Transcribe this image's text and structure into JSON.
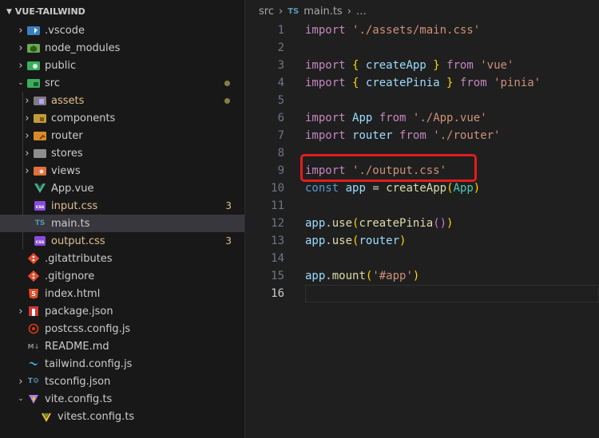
{
  "explorer": {
    "title": "VUE-TAILWIND",
    "items": [
      {
        "label": "vscode_dir",
        "text": ".vscode",
        "icon": "vscode-folder-icon"
      },
      {
        "label": "node_modules",
        "text": "node_modules",
        "icon": "node-folder-icon"
      },
      {
        "label": "public",
        "text": "public",
        "icon": "public-folder-icon"
      },
      {
        "label": "src",
        "text": "src",
        "icon": "src-folder-icon"
      },
      {
        "label": "assets",
        "text": "assets",
        "icon": "assets-folder-icon"
      },
      {
        "label": "components",
        "text": "components",
        "icon": "components-folder-icon"
      },
      {
        "label": "router",
        "text": "router",
        "icon": "router-folder-icon"
      },
      {
        "label": "stores",
        "text": "stores",
        "icon": "stores-folder-icon"
      },
      {
        "label": "views",
        "text": "views",
        "icon": "views-folder-icon"
      },
      {
        "label": "app_vue",
        "text": "App.vue",
        "icon": "vue-file-icon"
      },
      {
        "label": "input_css",
        "text": "input.css",
        "badge": "3",
        "icon": "css-file-icon"
      },
      {
        "label": "main_ts",
        "text": "main.ts",
        "icon": "ts-file-icon"
      },
      {
        "label": "output_css",
        "text": "output.css",
        "badge": "3",
        "icon": "css-file-icon"
      },
      {
        "label": "gitattributes",
        "text": ".gitattributes",
        "icon": "git-file-icon"
      },
      {
        "label": "gitignore",
        "text": ".gitignore",
        "icon": "git-file-icon"
      },
      {
        "label": "index_html",
        "text": "index.html",
        "icon": "html-file-icon"
      },
      {
        "label": "package_json",
        "text": "package.json",
        "icon": "npm-file-icon"
      },
      {
        "label": "postcss",
        "text": "postcss.config.js",
        "icon": "postcss-file-icon"
      },
      {
        "label": "readme",
        "text": "README.md",
        "icon": "markdown-file-icon"
      },
      {
        "label": "tailwind",
        "text": "tailwind.config.js",
        "icon": "tailwind-file-icon"
      },
      {
        "label": "tsconfig",
        "text": "tsconfig.json",
        "icon": "tsconfig-file-icon"
      },
      {
        "label": "vite_config",
        "text": "vite.config.ts",
        "icon": "vite-file-icon"
      },
      {
        "label": "vitest_config",
        "text": "vitest.config.ts",
        "icon": "vitest-file-icon"
      }
    ]
  },
  "breadcrumb": {
    "folder": "src",
    "sep": "›",
    "ts_badge": "TS",
    "file": "main.ts",
    "tail": "…"
  },
  "code": {
    "lines": [
      "1",
      "2",
      "3",
      "4",
      "5",
      "6",
      "7",
      "8",
      "9",
      "10",
      "11",
      "12",
      "13",
      "14",
      "15",
      "16"
    ],
    "l1": {
      "kw": "import",
      "str": "'./assets/main.css'"
    },
    "l3": {
      "kw": "import",
      "ob": "{",
      "name": "createApp",
      "cb": "}",
      "from": "from",
      "str": "'vue'"
    },
    "l4": {
      "kw": "import",
      "ob": "{",
      "name": "createPinia",
      "cb": "}",
      "from": "from",
      "str": "'pinia'"
    },
    "l6": {
      "kw": "import",
      "name": "App",
      "from": "from",
      "str": "'./App.vue'"
    },
    "l7": {
      "kw": "import",
      "name": "router",
      "from": "from",
      "str": "'./router'"
    },
    "l9": {
      "kw": "import",
      "str": "'./output.css'"
    },
    "l10": {
      "kw": "const",
      "name": "app",
      "eq": "=",
      "fn": "createApp",
      "op": "(",
      "arg": "App",
      "cp": ")"
    },
    "l12": {
      "obj": "app",
      "dot": ".",
      "fn": "use",
      "op": "(",
      "arg": "createPinia",
      "inner": "()",
      "cp": ")"
    },
    "l13": {
      "obj": "app",
      "dot": ".",
      "fn": "use",
      "op": "(",
      "arg": "router",
      "cp": ")"
    },
    "l15": {
      "obj": "app",
      "dot": ".",
      "fn": "mount",
      "op": "(",
      "str": "'#app'",
      "cp": ")"
    }
  },
  "colors": {
    "highlight": "#e11d1d",
    "keyword": "#c586c0",
    "string": "#ce9178",
    "variable": "#9cdcfe"
  }
}
